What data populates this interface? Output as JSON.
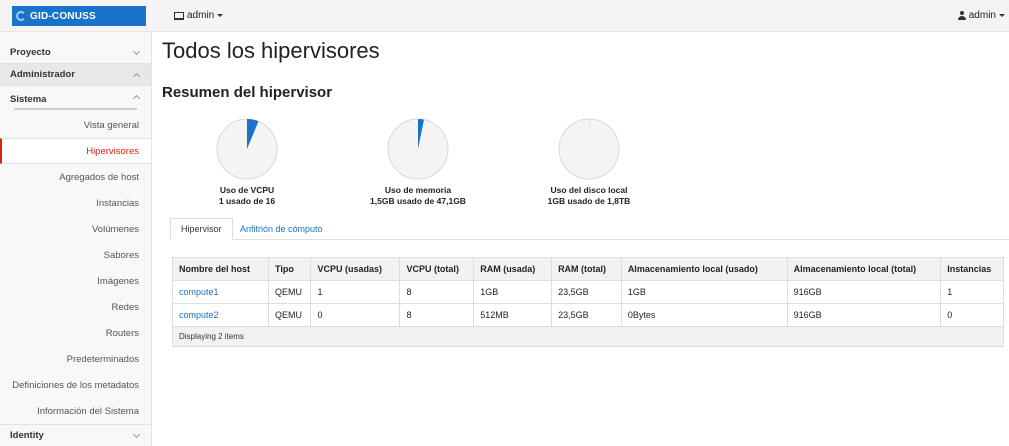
{
  "navbar": {
    "brand": "GID-CONUSS",
    "project_menu": "admin",
    "user_menu": "admin"
  },
  "sidebar": {
    "sections": {
      "proyecto": "Proyecto",
      "administrador": "Administrador",
      "sistema": "Sistema",
      "identity": "Identity"
    },
    "items": [
      "Vista general",
      "Hipervisores",
      "Agregados de host",
      "Instancias",
      "Volúmenes",
      "Sabores",
      "Imágenes",
      "Redes",
      "Routers",
      "Predeterminados",
      "Definiciones de los metadatos",
      "Información del Sistema"
    ],
    "active_item": "Hipervisores"
  },
  "page": {
    "title": "Todos los hipervisores",
    "summary_title": "Resumen del hipervisor"
  },
  "charts": [
    {
      "label": "Uso de VCPU",
      "detail": "1 usado de 16",
      "used": 1,
      "total": 16
    },
    {
      "label": "Uso de memoria",
      "detail": "1,5GB usado de 47,1GB",
      "used": 1.5,
      "total": 47.1
    },
    {
      "label": "Uso del disco local",
      "detail": "1GB usado de 1,8TB",
      "used": 1,
      "total": 1843.2
    }
  ],
  "colors": {
    "accent": "#1b73c9",
    "pie_bg": "#f4f4f4",
    "pie_border": "#d9d9d9",
    "active_red": "#d9230f"
  },
  "tabs": [
    "Hipervisor",
    "Anfitrión de cómputo"
  ],
  "table": {
    "headers": [
      "Nombre del host",
      "Tipo",
      "VCPU (usadas)",
      "VCPU (total)",
      "RAM (usada)",
      "RAM (total)",
      "Almacenamiento local (usado)",
      "Almacenamiento local (total)",
      "Instancias"
    ],
    "rows": [
      [
        "compute1",
        "QEMU",
        "1",
        "8",
        "1GB",
        "23,5GB",
        "1GB",
        "916GB",
        "1"
      ],
      [
        "compute2",
        "QEMU",
        "0",
        "8",
        "512MB",
        "23,5GB",
        "0Bytes",
        "916GB",
        "0"
      ]
    ],
    "footer": "Displaying 2 items"
  }
}
